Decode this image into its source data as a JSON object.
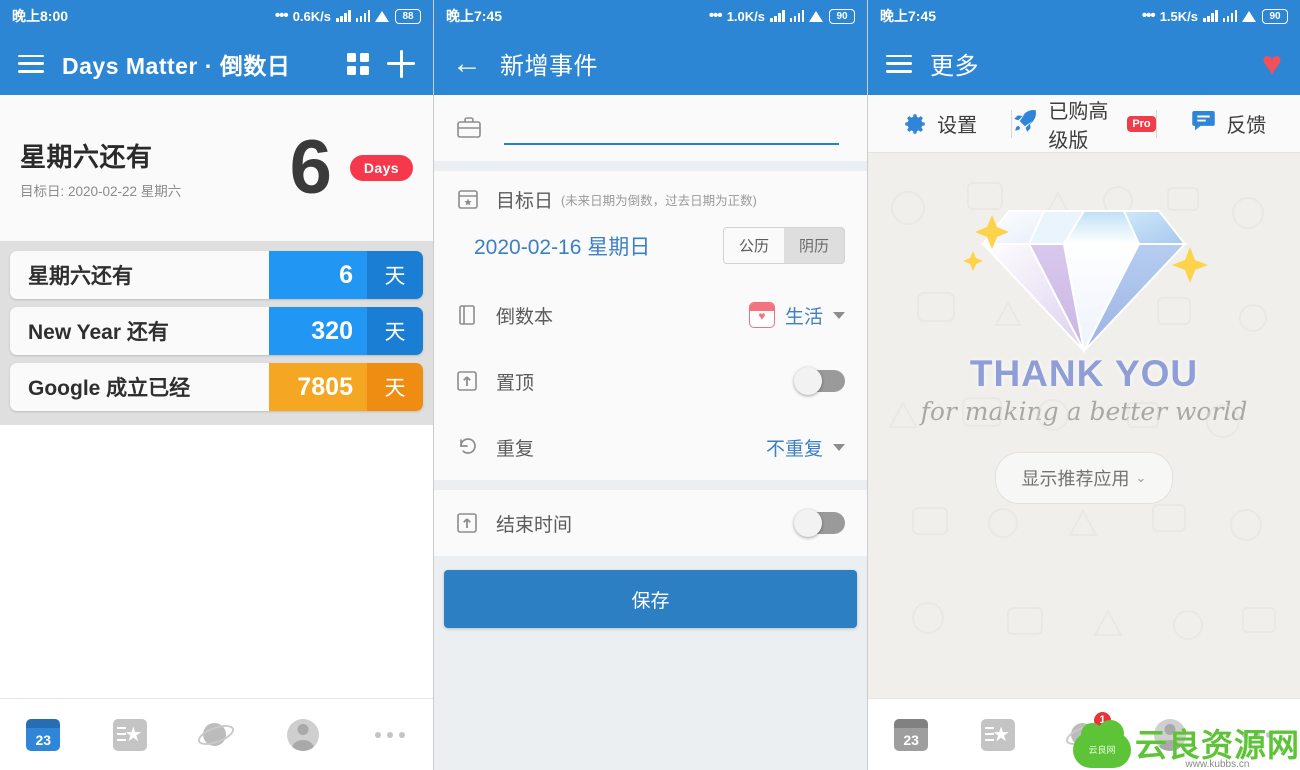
{
  "left": {
    "status": {
      "time": "晚上8:00",
      "net_speed": "0.6K/s",
      "battery": "88"
    },
    "appbar": {
      "title": "Days Matter · 倒数日",
      "menu_icon": "hamburger-icon",
      "grid_icon": "grid-view-icon",
      "add_icon": "plus-icon"
    },
    "hero": {
      "title": "星期六还有",
      "subtitle": "目标日: 2020-02-22 星期六",
      "number": "6",
      "unit_pill": "Days"
    },
    "events": [
      {
        "name": "星期六还有",
        "value": "6",
        "unit": "天",
        "color": "#2196f3",
        "unit_color": "#1a7fd4"
      },
      {
        "name": "New Year 还有",
        "value": "320",
        "unit": "天",
        "color": "#2196f3",
        "unit_color": "#1a7fd4"
      },
      {
        "name": "Google 成立已经",
        "value": "7805",
        "unit": "天",
        "color": "#f5a623",
        "unit_color": "#ef8c12"
      }
    ],
    "nav": [
      {
        "name": "calendar",
        "label": "23",
        "active": true
      },
      {
        "name": "notebook",
        "label": "",
        "active": false
      },
      {
        "name": "planet",
        "label": "",
        "active": false
      },
      {
        "name": "profile",
        "label": "",
        "active": false
      },
      {
        "name": "more",
        "label": "",
        "active": false
      }
    ]
  },
  "middle": {
    "status": {
      "time": "晚上7:45",
      "net_speed": "1.0K/s",
      "battery": "90"
    },
    "appbar": {
      "title": "新增事件",
      "back_icon": "back-arrow-icon"
    },
    "form": {
      "title_field": {
        "icon": "briefcase-icon",
        "value": "",
        "placeholder": ""
      },
      "target_date": {
        "icon": "calendar-star-icon",
        "label": "目标日",
        "hint": "(未来日期为倒数，过去日期为正数)",
        "value": "2020-02-16 星期日",
        "calendar_options": [
          "公历",
          "阴历"
        ],
        "calendar_selected": "公历"
      },
      "notebook": {
        "icon": "book-icon",
        "label": "倒数本",
        "value": "生活"
      },
      "pin_top": {
        "icon": "pin-top-icon",
        "label": "置顶",
        "on": false
      },
      "repeat": {
        "icon": "repeat-icon",
        "label": "重复",
        "value": "不重复"
      },
      "end_time": {
        "icon": "end-time-icon",
        "label": "结束时间",
        "on": false
      },
      "save_label": "保存"
    }
  },
  "right": {
    "status": {
      "time": "晚上7:45",
      "net_speed": "1.5K/s",
      "battery": "90"
    },
    "appbar": {
      "title": "更多",
      "menu_icon": "hamburger-icon",
      "favorite_icon": "heart-icon"
    },
    "actions": [
      {
        "name": "settings",
        "label": "设置",
        "icon": "gear-icon",
        "badge": ""
      },
      {
        "name": "premium",
        "label": "已购高级版",
        "icon": "rocket-icon",
        "badge": "Pro"
      },
      {
        "name": "feedback",
        "label": "反馈",
        "icon": "chat-icon",
        "badge": ""
      }
    ],
    "thankyou": {
      "headline": "THANK YOU",
      "subline": "for making a better world",
      "button": "显示推荐应用",
      "chevron": "⌄"
    },
    "nav": [
      {
        "name": "calendar",
        "label": "23",
        "active": false,
        "badge": ""
      },
      {
        "name": "notebook",
        "label": "",
        "active": false,
        "badge": ""
      },
      {
        "name": "planet",
        "label": "",
        "active": false,
        "badge": "1"
      },
      {
        "name": "profile",
        "label": "",
        "active": false,
        "badge": ""
      },
      {
        "name": "more",
        "label": "",
        "active": false,
        "badge": ""
      }
    ],
    "watermark": {
      "brand": "云良资源网",
      "mark": "云良网",
      "url": "www.kubbs.cn"
    }
  },
  "colors": {
    "primary": "#2d86d3",
    "accent_red": "#f5384c",
    "accent_orange": "#f5a623",
    "link_blue": "#3b7fc4"
  }
}
